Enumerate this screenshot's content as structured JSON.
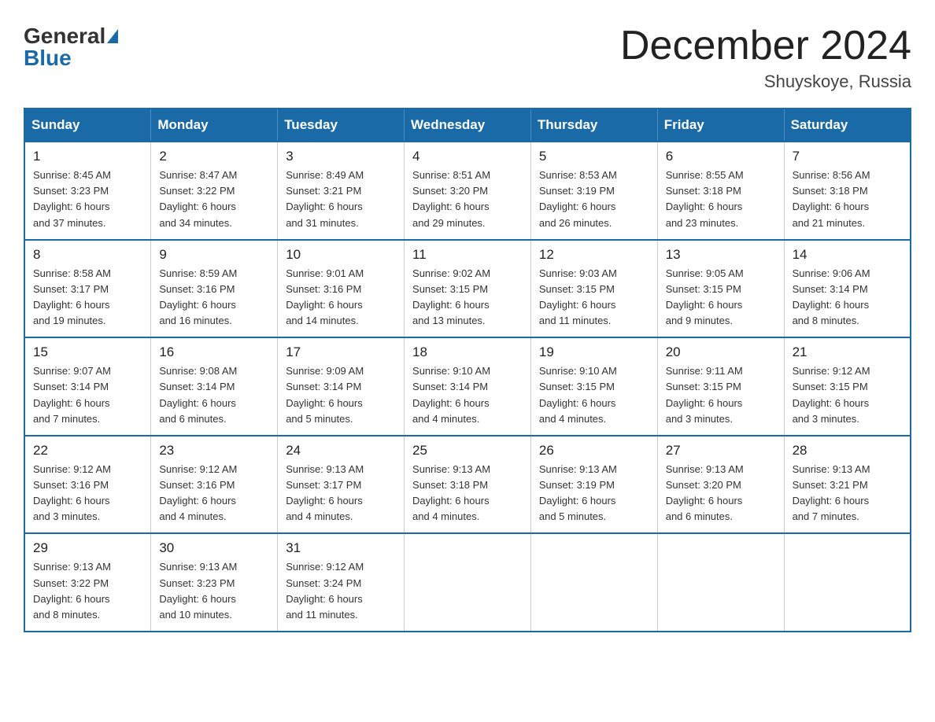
{
  "logo": {
    "general": "General",
    "blue": "Blue"
  },
  "title": "December 2024",
  "location": "Shuyskoye, Russia",
  "weekdays": [
    "Sunday",
    "Monday",
    "Tuesday",
    "Wednesday",
    "Thursday",
    "Friday",
    "Saturday"
  ],
  "weeks": [
    [
      {
        "day": "1",
        "sunrise": "8:45 AM",
        "sunset": "3:23 PM",
        "daylight": "6 hours and 37 minutes."
      },
      {
        "day": "2",
        "sunrise": "8:47 AM",
        "sunset": "3:22 PM",
        "daylight": "6 hours and 34 minutes."
      },
      {
        "day": "3",
        "sunrise": "8:49 AM",
        "sunset": "3:21 PM",
        "daylight": "6 hours and 31 minutes."
      },
      {
        "day": "4",
        "sunrise": "8:51 AM",
        "sunset": "3:20 PM",
        "daylight": "6 hours and 29 minutes."
      },
      {
        "day": "5",
        "sunrise": "8:53 AM",
        "sunset": "3:19 PM",
        "daylight": "6 hours and 26 minutes."
      },
      {
        "day": "6",
        "sunrise": "8:55 AM",
        "sunset": "3:18 PM",
        "daylight": "6 hours and 23 minutes."
      },
      {
        "day": "7",
        "sunrise": "8:56 AM",
        "sunset": "3:18 PM",
        "daylight": "6 hours and 21 minutes."
      }
    ],
    [
      {
        "day": "8",
        "sunrise": "8:58 AM",
        "sunset": "3:17 PM",
        "daylight": "6 hours and 19 minutes."
      },
      {
        "day": "9",
        "sunrise": "8:59 AM",
        "sunset": "3:16 PM",
        "daylight": "6 hours and 16 minutes."
      },
      {
        "day": "10",
        "sunrise": "9:01 AM",
        "sunset": "3:16 PM",
        "daylight": "6 hours and 14 minutes."
      },
      {
        "day": "11",
        "sunrise": "9:02 AM",
        "sunset": "3:15 PM",
        "daylight": "6 hours and 13 minutes."
      },
      {
        "day": "12",
        "sunrise": "9:03 AM",
        "sunset": "3:15 PM",
        "daylight": "6 hours and 11 minutes."
      },
      {
        "day": "13",
        "sunrise": "9:05 AM",
        "sunset": "3:15 PM",
        "daylight": "6 hours and 9 minutes."
      },
      {
        "day": "14",
        "sunrise": "9:06 AM",
        "sunset": "3:14 PM",
        "daylight": "6 hours and 8 minutes."
      }
    ],
    [
      {
        "day": "15",
        "sunrise": "9:07 AM",
        "sunset": "3:14 PM",
        "daylight": "6 hours and 7 minutes."
      },
      {
        "day": "16",
        "sunrise": "9:08 AM",
        "sunset": "3:14 PM",
        "daylight": "6 hours and 6 minutes."
      },
      {
        "day": "17",
        "sunrise": "9:09 AM",
        "sunset": "3:14 PM",
        "daylight": "6 hours and 5 minutes."
      },
      {
        "day": "18",
        "sunrise": "9:10 AM",
        "sunset": "3:14 PM",
        "daylight": "6 hours and 4 minutes."
      },
      {
        "day": "19",
        "sunrise": "9:10 AM",
        "sunset": "3:15 PM",
        "daylight": "6 hours and 4 minutes."
      },
      {
        "day": "20",
        "sunrise": "9:11 AM",
        "sunset": "3:15 PM",
        "daylight": "6 hours and 3 minutes."
      },
      {
        "day": "21",
        "sunrise": "9:12 AM",
        "sunset": "3:15 PM",
        "daylight": "6 hours and 3 minutes."
      }
    ],
    [
      {
        "day": "22",
        "sunrise": "9:12 AM",
        "sunset": "3:16 PM",
        "daylight": "6 hours and 3 minutes."
      },
      {
        "day": "23",
        "sunrise": "9:12 AM",
        "sunset": "3:16 PM",
        "daylight": "6 hours and 4 minutes."
      },
      {
        "day": "24",
        "sunrise": "9:13 AM",
        "sunset": "3:17 PM",
        "daylight": "6 hours and 4 minutes."
      },
      {
        "day": "25",
        "sunrise": "9:13 AM",
        "sunset": "3:18 PM",
        "daylight": "6 hours and 4 minutes."
      },
      {
        "day": "26",
        "sunrise": "9:13 AM",
        "sunset": "3:19 PM",
        "daylight": "6 hours and 5 minutes."
      },
      {
        "day": "27",
        "sunrise": "9:13 AM",
        "sunset": "3:20 PM",
        "daylight": "6 hours and 6 minutes."
      },
      {
        "day": "28",
        "sunrise": "9:13 AM",
        "sunset": "3:21 PM",
        "daylight": "6 hours and 7 minutes."
      }
    ],
    [
      {
        "day": "29",
        "sunrise": "9:13 AM",
        "sunset": "3:22 PM",
        "daylight": "6 hours and 8 minutes."
      },
      {
        "day": "30",
        "sunrise": "9:13 AM",
        "sunset": "3:23 PM",
        "daylight": "6 hours and 10 minutes."
      },
      {
        "day": "31",
        "sunrise": "9:12 AM",
        "sunset": "3:24 PM",
        "daylight": "6 hours and 11 minutes."
      },
      null,
      null,
      null,
      null
    ]
  ],
  "labels": {
    "sunrise": "Sunrise:",
    "sunset": "Sunset:",
    "daylight": "Daylight:"
  }
}
